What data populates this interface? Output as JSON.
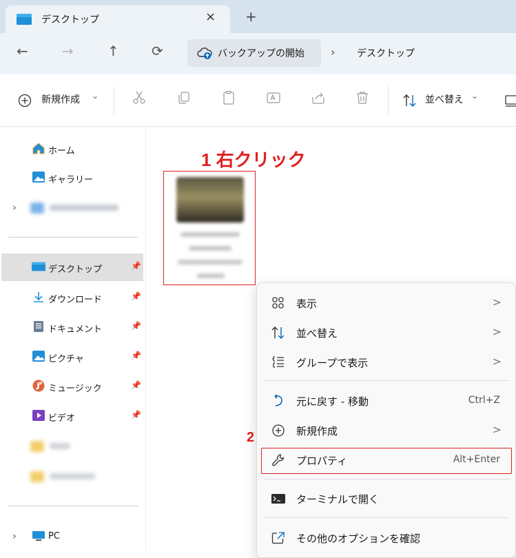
{
  "tab": {
    "title": "デスクトップ",
    "close": "×",
    "new_tab": "+"
  },
  "nav": {
    "back": "←",
    "forward": "→",
    "up": "↑",
    "refresh": "⟳"
  },
  "address": {
    "backup": "バックアップの開始",
    "separator": "›",
    "current": "デスクトップ"
  },
  "toolbar": {
    "new_label": "新規作成",
    "new_chevron": "⌄",
    "sort_label": "並べ替え",
    "sort_chevron": "⌄"
  },
  "sidebar": {
    "home": "ホーム",
    "gallery": "ギャラリー",
    "desktop": "デスクトップ",
    "downloads": "ダウンロード",
    "documents": "ドキュメント",
    "pictures": "ピクチャ",
    "music": "ミュージック",
    "videos": "ビデオ",
    "pc": "PC",
    "pin": "📌",
    "expand": "›"
  },
  "annotations": {
    "step1": "1 右クリック",
    "step2": "2"
  },
  "context_menu": {
    "items": [
      {
        "label": "表示",
        "icon": "grid-view-icon",
        "chevron": ">"
      },
      {
        "label": "並べ替え",
        "icon": "sort-icon",
        "chevron": ">"
      },
      {
        "label": "グループで表示",
        "icon": "group-icon",
        "chevron": ">"
      },
      {
        "label": "元に戻す - 移動",
        "icon": "undo-icon",
        "shortcut": "Ctrl+Z"
      },
      {
        "label": "新規作成",
        "icon": "new-icon",
        "chevron": ">"
      },
      {
        "label": "プロパティ",
        "icon": "wrench-icon",
        "shortcut": "Alt+Enter"
      },
      {
        "label": "ターミナルで開く",
        "icon": "terminal-icon"
      },
      {
        "label": "その他のオプションを確認",
        "icon": "more-options-icon"
      }
    ]
  },
  "colors": {
    "accent": "#0067c0",
    "annotation": "#e02020",
    "tabstrip": "#d6e3ee"
  }
}
